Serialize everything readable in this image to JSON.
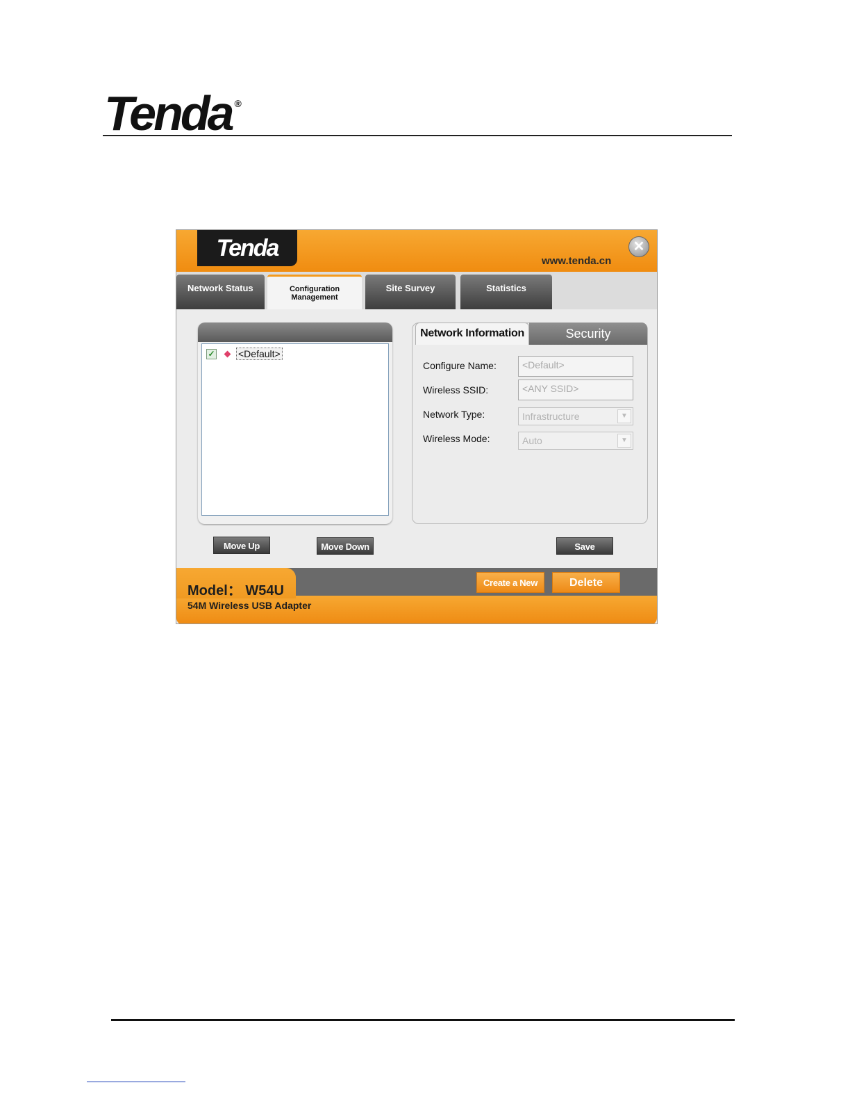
{
  "page": {
    "brand": "Tenda",
    "registered_mark": "®"
  },
  "app": {
    "brand": "Tenda",
    "website": "www.tenda.cn",
    "close_glyph": "✕"
  },
  "tabs": [
    {
      "label": "Network Status",
      "active": false
    },
    {
      "label": "Configuration Management",
      "active": true
    },
    {
      "label": "Site Survey",
      "active": false
    },
    {
      "label": "Statistics",
      "active": false
    }
  ],
  "profiles": {
    "items": [
      {
        "label": "<Default>",
        "checked": true
      }
    ],
    "check_glyph": "✓"
  },
  "info_tabs": {
    "network_information": "Network Information",
    "security": "Security"
  },
  "form": {
    "configure_name": {
      "label": "Configure Name:",
      "value": "<Default>"
    },
    "wireless_ssid": {
      "label": "Wireless SSID:",
      "value": "<ANY SSID>"
    },
    "network_type": {
      "label": "Network Type:",
      "value": "Infrastructure"
    },
    "wireless_mode": {
      "label": "Wireless Mode:",
      "value": "Auto"
    }
  },
  "buttons": {
    "move_up": "Move Up",
    "move_down": "Move Down",
    "save": "Save",
    "create_new": "Create a New",
    "delete": "Delete"
  },
  "footer": {
    "model": "Model： W54U",
    "description": "54M Wireless USB Adapter"
  },
  "colors": {
    "accent_orange": "#f39a1e",
    "dark_grey": "#3e3e3e",
    "profile_marker": "#e0406a"
  }
}
